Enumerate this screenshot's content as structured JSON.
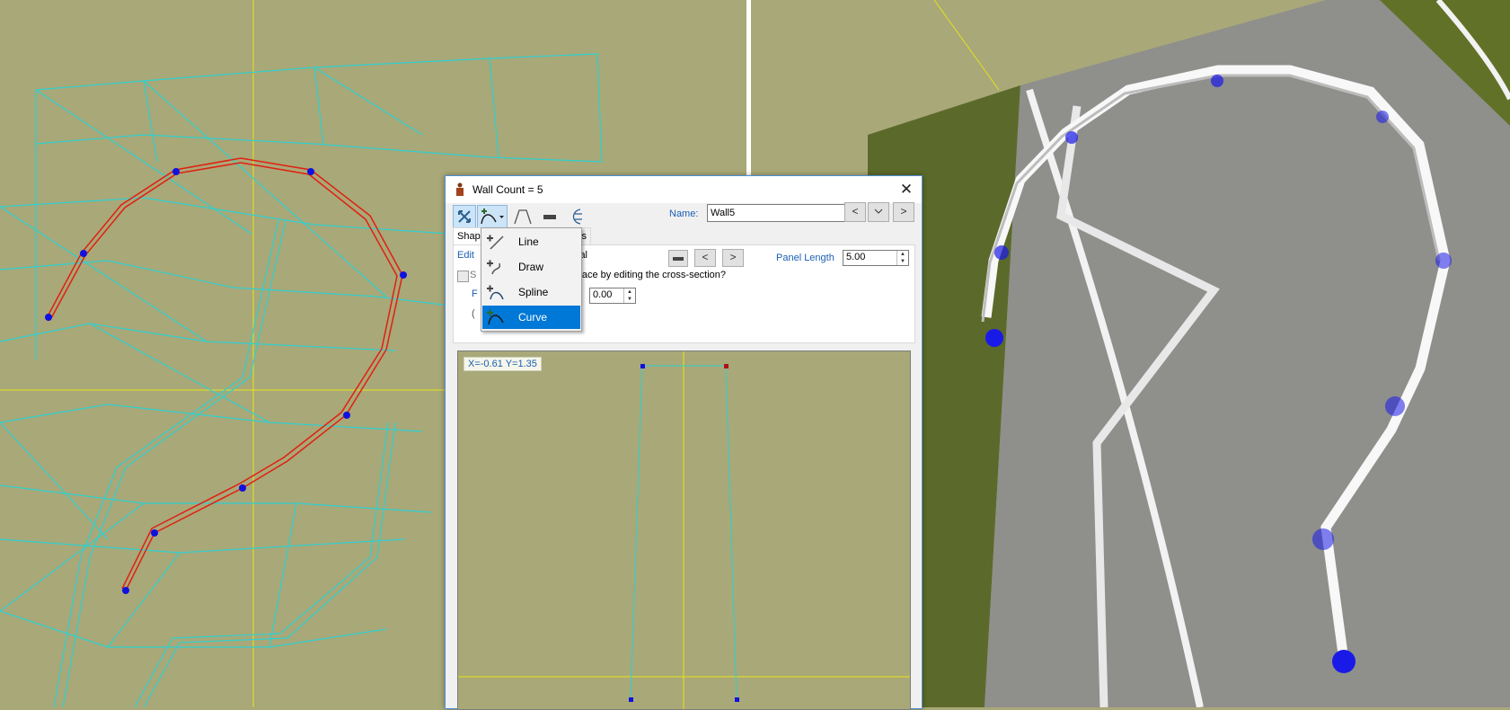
{
  "dialog": {
    "title": "Wall Count = 5",
    "name_label": "Name:",
    "name_value": "Wall5",
    "tabs": [
      "Shap",
      "ies"
    ],
    "edit_link": "Edit",
    "material_fragment": "ial",
    "panel_length_label": "Panel Length",
    "panel_length_value": "5.00",
    "question_fragment": "urface by editing the cross-section?",
    "checkbox_fragment": "S",
    "row_letter": "F",
    "row_value": "0.00",
    "radio_fragment": "(",
    "coord_readout": "X=-0.61 Y=1.35"
  },
  "draw_menu": {
    "items": [
      {
        "label": "Line",
        "selected": false
      },
      {
        "label": "Draw",
        "selected": false
      },
      {
        "label": "Spline",
        "selected": false
      },
      {
        "label": "Curve",
        "selected": true
      }
    ]
  },
  "icons": {
    "close": "close-icon",
    "app": "wall-app-icon",
    "select": "select-tool-icon",
    "curve_tool": "curve-tool-icon",
    "profile": "profile-icon",
    "panel": "panel-icon",
    "cross_section": "cross-section-icon"
  },
  "colors": {
    "terrain": "#a9a878",
    "wireframe": "#2fd0d0",
    "wall_path": "#e02010",
    "control_point": "#1010e0",
    "accent": "#0078d7"
  }
}
